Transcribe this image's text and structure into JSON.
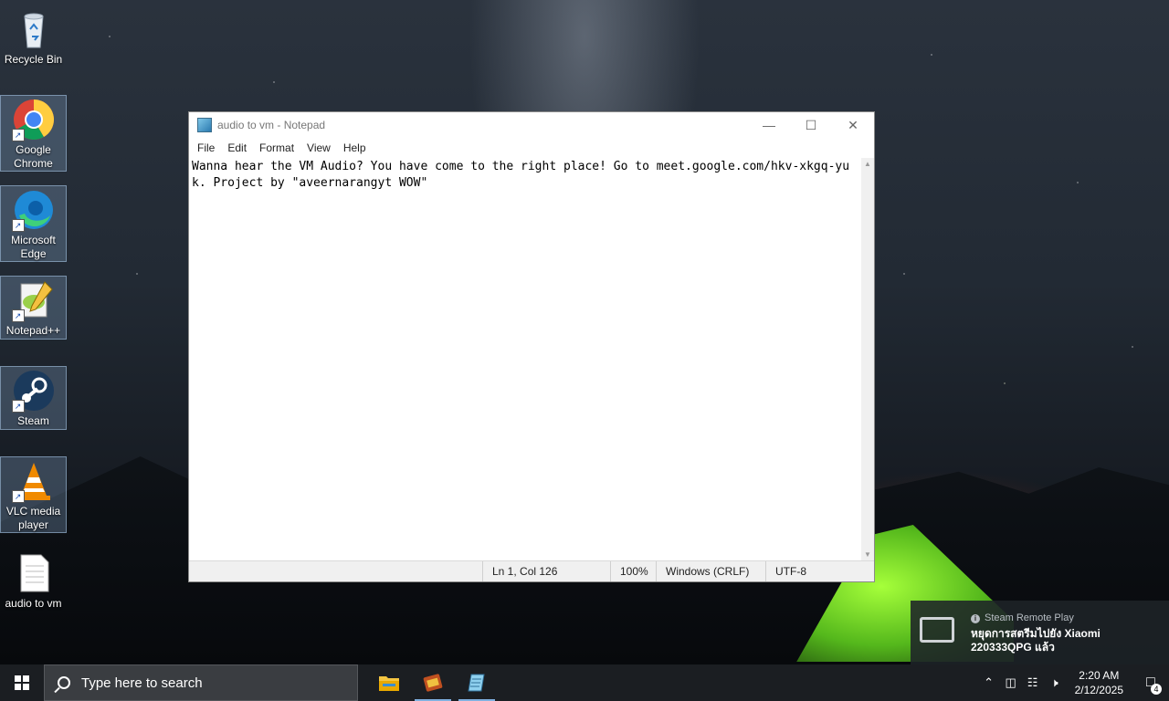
{
  "desktop": {
    "icons": [
      {
        "label": "Recycle Bin"
      },
      {
        "label": "Google Chrome"
      },
      {
        "label": "Microsoft Edge"
      },
      {
        "label": "Notepad++"
      },
      {
        "label": "Steam"
      },
      {
        "label": "VLC media player"
      },
      {
        "label": "audio to vm"
      }
    ]
  },
  "notepad": {
    "title": "audio to vm - Notepad",
    "menu": [
      "File",
      "Edit",
      "Format",
      "View",
      "Help"
    ],
    "content": "Wanna hear the VM Audio? You have come to the right place! Go to meet.google.com/hkv-xkgq-yuk. Project by \"aveernarangyt WOW\"",
    "status": {
      "position": "Ln 1, Col 126",
      "zoom": "100%",
      "line_ending": "Windows (CRLF)",
      "encoding": "UTF-8"
    }
  },
  "notification": {
    "app": "Steam Remote Play",
    "message": "หยุดการสตรีมไปยัง Xiaomi 220333QPG แล้ว"
  },
  "taskbar": {
    "search_placeholder": "Type here to search",
    "time": "2:20 AM",
    "date": "2/12/2025",
    "notification_count": "4"
  }
}
